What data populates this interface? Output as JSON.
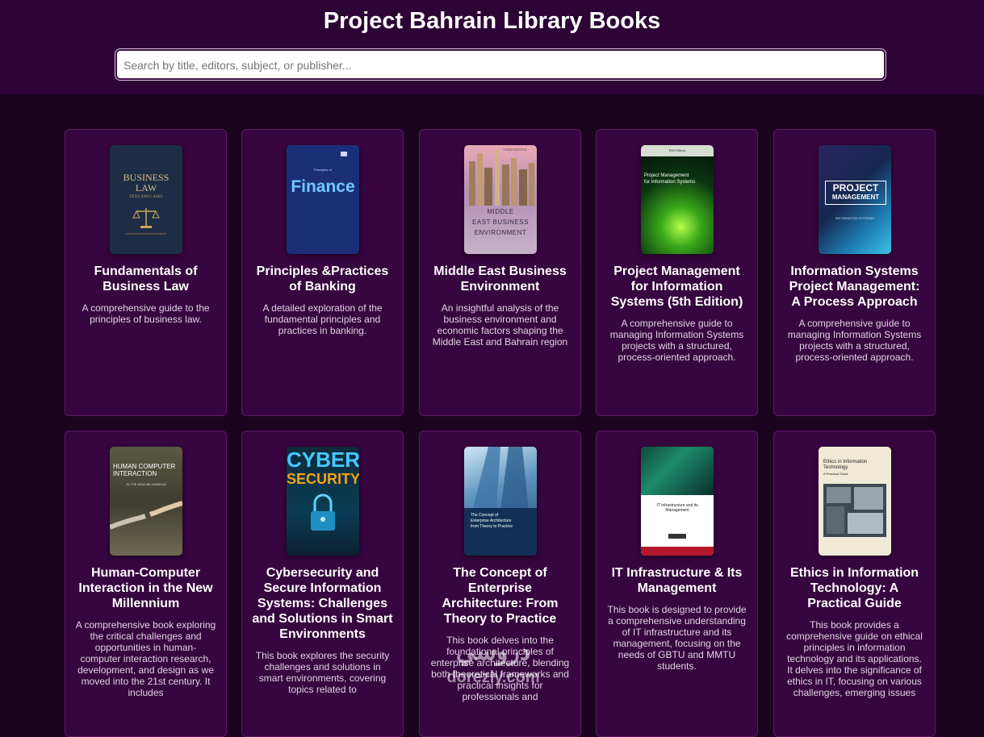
{
  "header": {
    "title": "Project Bahrain Library Books",
    "search_placeholder": "Search by title, editors, subject, or publisher..."
  },
  "books": [
    {
      "title": "Fundamentals of Business Law",
      "description": "A comprehensive guide to the principles of business law.",
      "cover_text": [
        "BUSINESS",
        "LAW"
      ],
      "cover_sub": "TEXT AND CASES"
    },
    {
      "title": "Principles &Practices of Banking",
      "description": "A detailed exploration of the fundamental principles and practices in banking.",
      "cover_text": [
        "Finance"
      ],
      "cover_sub": "Principles of"
    },
    {
      "title": "Middle East Business Environment",
      "description": "An insightful analysis of the business environment and economic factors shaping the Middle East and Bahrain region",
      "cover_text": [
        "MIDDLE",
        "EAST BUSINESS",
        "ENVIRONMENT"
      ],
      "cover_sub": "THIRD EDITION"
    },
    {
      "title": "Project Management for Information Systems (5th Edition)",
      "description": "A comprehensive guide to managing Information Systems projects with a structured, process-oriented approach.",
      "cover_text": [
        "Project Management",
        "for Information Systems"
      ],
      "cover_sub": "Fifth Edition"
    },
    {
      "title": "Information Systems Project Management: A Process Approach",
      "description": "A comprehensive guide to managing Information Systems projects with a structured, process-oriented approach.",
      "cover_text": [
        "PROJECT",
        "MANAGEMENT"
      ],
      "cover_sub": "INFORMATION SYSTEMS"
    },
    {
      "title": "Human-Computer Interaction in the New Millennium",
      "description": "A comprehensive book exploring the critical challenges and opportunities in human-computer interaction research, development, and design as we moved into the 21st century. It includes",
      "cover_text": [
        "HUMAN COMPUTER",
        "INTERACTION"
      ],
      "cover_sub": "IN THE NEW MILLENNIUM"
    },
    {
      "title": "Cybersecurity and Secure Information Systems: Challenges and Solutions in Smart Environments",
      "description": "This book explores the security challenges and solutions in smart environments, covering topics related to",
      "cover_text": [
        "CYBER",
        "SECURITY"
      ],
      "cover_sub": ""
    },
    {
      "title": "The Concept of Enterprise Architecture: From Theory to Practice",
      "description": "This book delves into the foundational principles of enterprise architecture, blending both theoretical frameworks and practical insights for professionals and",
      "cover_text": [
        "The Concept of",
        "Enterprise Architecture",
        "from Theory to Practice"
      ],
      "cover_sub": ""
    },
    {
      "title": "IT Infrastructure & Its Management",
      "description": "This book is designed to provide a comprehensive understanding of IT infrastructure and its management, focusing on the needs of GBTU and MMTU students.",
      "cover_text": [
        "IT Infrastructure and its",
        "Management"
      ],
      "cover_sub": ""
    },
    {
      "title": "Ethics in Information Technology: A Practical Guide",
      "description": "This book provides a comprehensive guide on ethical principles in information technology and its applications. It delves into the significance of ethics in IT, focusing on various challenges, emerging issues",
      "cover_text": [
        "Ethics in Information",
        "Technology",
        "A Practical Guide"
      ],
      "cover_sub": ""
    }
  ],
  "watermark": {
    "line1": "دروسي",
    "line2": "dorezly.com"
  },
  "colors": {
    "page_bg": "#1c0420",
    "header_bg": "#2d0436",
    "card_bg": "#37053f",
    "card_border": "#5c1868"
  }
}
